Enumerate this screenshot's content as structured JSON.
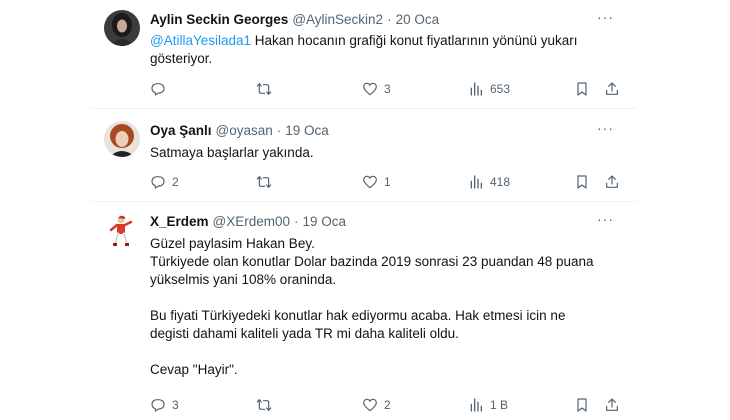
{
  "tweets": [
    {
      "name": "Aylin Seckin Georges",
      "handle": "@AylinSeckin2",
      "date": "20 Oca",
      "mention": "@AtillaYesilada1",
      "text": " Hakan hocanın grafiği konut fiyatlarının yönünü yukarı gösteriyor.",
      "replies": "",
      "retweets": "",
      "likes": "3",
      "views": "653"
    },
    {
      "name": "Oya Şanlı",
      "handle": "@oyasan",
      "date": "19 Oca",
      "text": "Satmaya başlarlar yakında.",
      "replies": "2",
      "retweets": "",
      "likes": "1",
      "views": "418"
    },
    {
      "name": "X_Erdem",
      "handle": "@XErdem00",
      "date": "19 Oca",
      "lines": [
        "Güzel paylasim Hakan Bey.",
        "Türkiyede olan konutlar Dolar bazinda 2019 sonrasi 23 puandan 48 puana",
        "yükselmis yani 108% oraninda.",
        "",
        "Bu fiyati Türkiyedeki konutlar hak ediyormu acaba. Hak etmesi icin ne",
        "degisti  dahami kaliteli yada TR mi daha kaliteli oldu.",
        "",
        "Cevap \"Hayir\"."
      ],
      "replies": "3",
      "retweets": "",
      "likes": "2",
      "views": "1 B"
    }
  ],
  "more_label": "···",
  "colors": {
    "accent": "#1d9bf0",
    "muted": "#536471",
    "text": "#0f1419",
    "divider": "#eff3f4"
  },
  "icons": [
    "reply-icon",
    "retweet-icon",
    "like-icon",
    "views-icon",
    "bookmark-icon",
    "share-icon"
  ]
}
